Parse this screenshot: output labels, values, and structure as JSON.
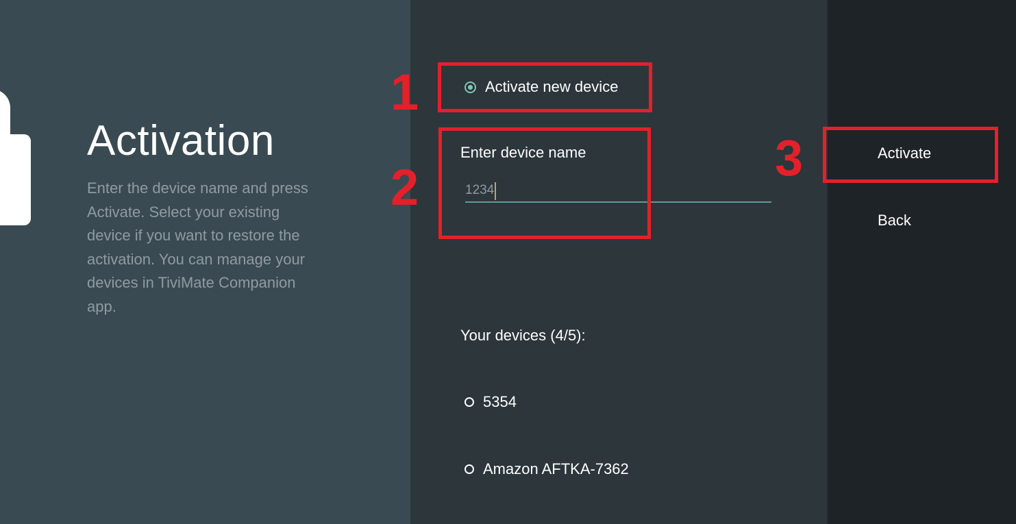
{
  "screen": {
    "title": "Activation",
    "description": "Enter the device name and press Activate. Select your existing device if you want to restore the activation. You can manage your devices in TiviMate Companion app."
  },
  "options": {
    "new_device_label": "Activate new device",
    "new_device_selected": true
  },
  "device_name": {
    "label": "Enter device name",
    "value": "1234"
  },
  "devices": {
    "heading": "Your devices (4/5):",
    "items": [
      {
        "label": "5354",
        "selected": false
      },
      {
        "label": "Amazon AFTKA-7362",
        "selected": false
      }
    ]
  },
  "actions": {
    "activate_label": "Activate",
    "back_label": "Back"
  },
  "annotations": {
    "step1": "1",
    "step2": "2",
    "step3": "3",
    "color": "#e4202a"
  },
  "colors": {
    "accent": "#7fc7b8",
    "input_underline": "#5e9c93",
    "left_panel_bg": "#3a4a52",
    "mid_panel_bg": "#2c363b",
    "right_panel_bg": "#1e2328"
  }
}
